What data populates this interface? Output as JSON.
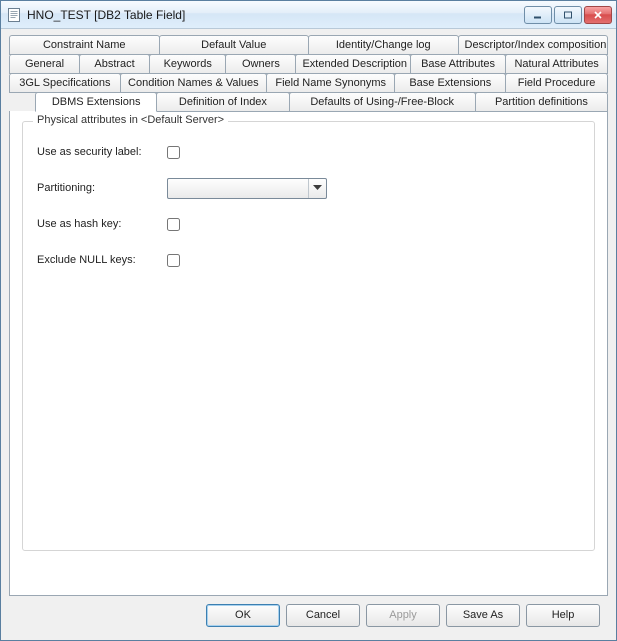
{
  "window": {
    "title": "HNO_TEST [DB2 Table Field]"
  },
  "tabs": {
    "row1": [
      {
        "label": "Constraint Name"
      },
      {
        "label": "Default Value"
      },
      {
        "label": "Identity/Change log"
      },
      {
        "label": "Descriptor/Index composition"
      }
    ],
    "row2": [
      {
        "label": "General"
      },
      {
        "label": "Abstract"
      },
      {
        "label": "Keywords"
      },
      {
        "label": "Owners"
      },
      {
        "label": "Extended Description"
      },
      {
        "label": "Base Attributes"
      },
      {
        "label": "Natural Attributes"
      }
    ],
    "row3": [
      {
        "label": "3GL Specifications"
      },
      {
        "label": "Condition Names & Values"
      },
      {
        "label": "Field Name Synonyms"
      },
      {
        "label": "Base Extensions"
      },
      {
        "label": "Field Procedure"
      }
    ],
    "row4": [
      {
        "label": "DBMS Extensions",
        "active": true
      },
      {
        "label": "Definition of Index"
      },
      {
        "label": "Defaults of Using-/Free-Block"
      },
      {
        "label": "Partition definitions"
      }
    ]
  },
  "group": {
    "title": "Physical attributes in <Default Server>",
    "fields": {
      "security_label": {
        "label": "Use as security label:",
        "checked": false
      },
      "partitioning": {
        "label": "Partitioning:",
        "value": ""
      },
      "hash_key": {
        "label": "Use as hash key:",
        "checked": false
      },
      "exclude_null": {
        "label": "Exclude NULL keys:",
        "checked": false
      }
    }
  },
  "buttons": {
    "ok": "OK",
    "cancel": "Cancel",
    "apply": "Apply",
    "saveas": "Save As",
    "help": "Help"
  }
}
